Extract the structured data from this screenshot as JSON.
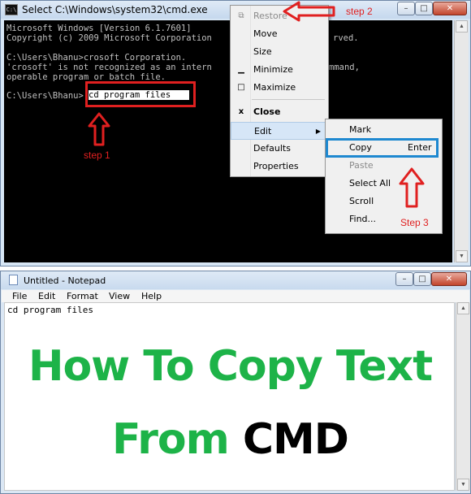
{
  "cmd": {
    "title": "Select C:\\Windows\\system32\\cmd.exe",
    "lines": [
      "Microsoft Windows [Version 6.1.7601]",
      "Copyright (c) 2009 Microsoft Corporation",
      "C:\\Users\\Bhanu>crosoft Corporation.",
      "'crosoft' is not recognized as an intern",
      "operable program or batch file.",
      "C:\\Users\\Bhanu>"
    ],
    "line1_tail": "rved.",
    "line4_tail": "mmand,",
    "selected_text": "cd program files"
  },
  "window_buttons": {
    "minimize": "–",
    "maximize": "□",
    "close": "✕"
  },
  "system_menu": {
    "items": [
      {
        "icon": "⧉",
        "label": "Restore"
      },
      {
        "icon": "",
        "label": "Move"
      },
      {
        "icon": "",
        "label": "Size"
      },
      {
        "icon": "▁",
        "label": "Minimize"
      },
      {
        "icon": "□",
        "label": "Maximize"
      },
      {
        "icon": "x",
        "label": "Close"
      },
      {
        "icon": "",
        "label": "Edit"
      },
      {
        "icon": "",
        "label": "Defaults"
      },
      {
        "icon": "",
        "label": "Properties"
      }
    ]
  },
  "edit_menu": {
    "items": [
      {
        "label": "Mark",
        "shortcut": ""
      },
      {
        "label": "Copy",
        "shortcut": "Enter"
      },
      {
        "label": "Paste",
        "shortcut": ""
      },
      {
        "label": "Select All",
        "shortcut": ""
      },
      {
        "label": "Scroll",
        "shortcut": ""
      },
      {
        "label": "Find...",
        "shortcut": ""
      }
    ]
  },
  "annotations": {
    "step1": "step 1",
    "step2": "step 2",
    "step3": "Step 3"
  },
  "notepad": {
    "title": "Untitled - Notepad",
    "menus": [
      "File",
      "Edit",
      "Format",
      "View",
      "Help"
    ],
    "content": "cd program files"
  },
  "headline": {
    "line1": "How To Copy Text",
    "line2_part1": "From ",
    "line2_part2": "CMD"
  },
  "colors": {
    "headline_green": "#1db348",
    "annotation_red": "#e02020",
    "highlight_blue": "#1e88d0"
  }
}
